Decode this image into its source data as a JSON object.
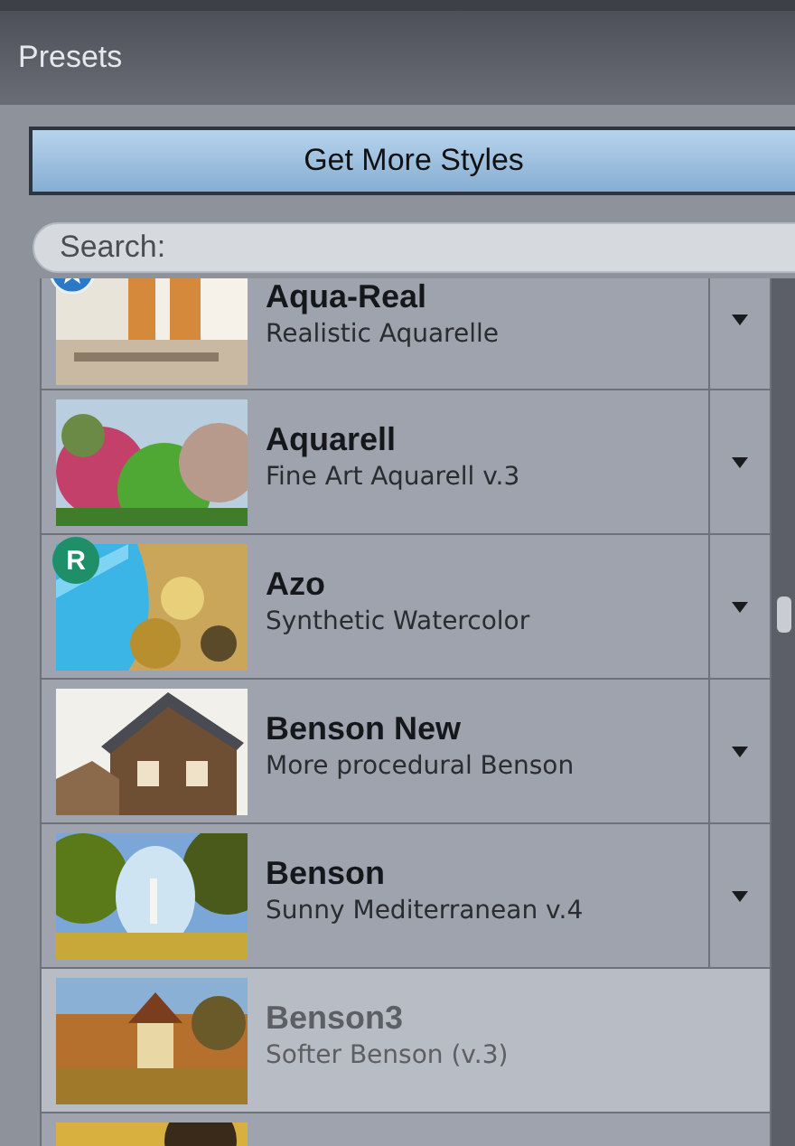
{
  "panel": {
    "title": "Presets"
  },
  "get_more_button": {
    "label": "Get More Styles"
  },
  "search": {
    "placeholder": "Search:"
  },
  "presets": [
    {
      "title": "Aqua-Real",
      "subtitle": "Realistic Aquarelle",
      "menu": true,
      "selected": false,
      "badge": {
        "kind": "star"
      }
    },
    {
      "title": "Aquarell",
      "subtitle": "Fine Art Aquarell v.3",
      "menu": true,
      "selected": false
    },
    {
      "title": "Azo",
      "subtitle": "Synthetic Watercolor",
      "menu": true,
      "selected": false,
      "badge": {
        "kind": "letter",
        "text": "R"
      }
    },
    {
      "title": "Benson New",
      "subtitle": "More procedural Benson",
      "menu": true,
      "selected": false
    },
    {
      "title": "Benson",
      "subtitle": "Sunny Mediterranean v.4",
      "menu": true,
      "selected": false
    },
    {
      "title": "Benson3",
      "subtitle": "Softer Benson (v.3)",
      "menu": false,
      "selected": true
    },
    {
      "menu": false,
      "selected": false
    }
  ]
}
